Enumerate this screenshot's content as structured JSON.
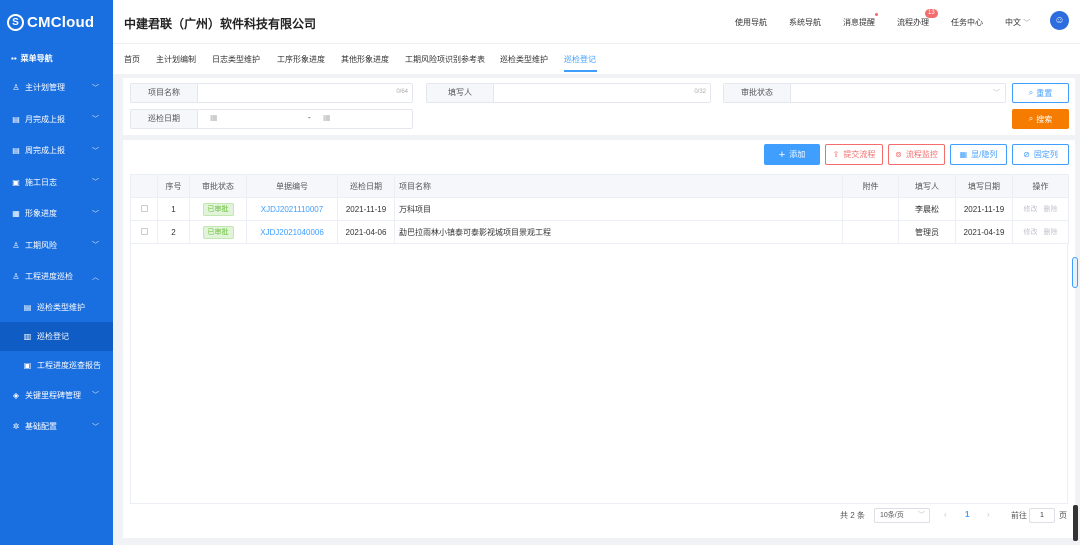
{
  "brand": {
    "logo_glyph": "S",
    "name": "CMCloud"
  },
  "sidebar": {
    "header": "菜单导航",
    "items": [
      {
        "label": "主计划管理",
        "icon": "org-icon"
      },
      {
        "label": "月完成上报",
        "icon": "report-icon"
      },
      {
        "label": "周完成上报",
        "icon": "report-icon"
      },
      {
        "label": "施工日志",
        "icon": "log-icon"
      },
      {
        "label": "形象进度",
        "icon": "progress-icon"
      },
      {
        "label": "工期风险",
        "icon": "org-icon"
      },
      {
        "label": "工程进度巡检",
        "icon": "org-icon"
      }
    ],
    "subitems": [
      {
        "label": "巡检类型维护"
      },
      {
        "label": "巡检登记"
      },
      {
        "label": "工程进度巡查报告"
      }
    ],
    "bottom_items": [
      {
        "label": "关键里程碑管理",
        "icon": "milestone-icon"
      },
      {
        "label": "基础配置",
        "icon": "gear-icon"
      }
    ]
  },
  "header": {
    "company": "中建君联（广州）软件科技有限公司",
    "nav": [
      "使用导航",
      "系统导航",
      "消息提醒",
      "流程办理",
      "任务中心",
      "中文"
    ],
    "badge": "13"
  },
  "tabs": [
    "首页",
    "主计划编制",
    "日志类型维护",
    "工序形象进度",
    "其他形象进度",
    "工期风险项识别参考表",
    "巡检类型维护",
    "巡检登记"
  ],
  "filter": {
    "project_name_label": "项目名称",
    "project_name_count": "0/64",
    "filler_label": "填写人",
    "filler_count": "0/32",
    "approval_label": "审批状态",
    "date_label": "巡检日期",
    "date_sep": "-",
    "reset": "重置",
    "search": "搜索"
  },
  "toolbar": {
    "add": "添加",
    "submit_flow": "提交流程",
    "monitor_flow": "流程监控",
    "show_hide": "显/隐列",
    "fix_cols": "固定列"
  },
  "table": {
    "columns": [
      "序号",
      "审批状态",
      "单据编号",
      "巡检日期",
      "项目名称",
      "附件",
      "填写人",
      "填写日期",
      "操作"
    ],
    "rows": [
      {
        "no": "1",
        "status": "已审批",
        "code": "XJDJ2021110007",
        "date": "2021-11-19",
        "project": "万科项目",
        "attach": "",
        "filler": "李晨松",
        "fill_date": "2021-11-19",
        "edit": "修改",
        "del": "删除"
      },
      {
        "no": "2",
        "status": "已审批",
        "code": "XJDJ2021040006",
        "date": "2021-04-06",
        "project": "勐巴拉雨林小镇泰可泰影视城项目景观工程",
        "attach": "",
        "filler": "管理员",
        "fill_date": "2021-04-19",
        "edit": "修改",
        "del": "删除"
      }
    ]
  },
  "pagination": {
    "total": "共 2 条",
    "page_size": "10条/页",
    "current": "1",
    "goto": "前往",
    "goto_value": "1",
    "page_unit": "页"
  }
}
